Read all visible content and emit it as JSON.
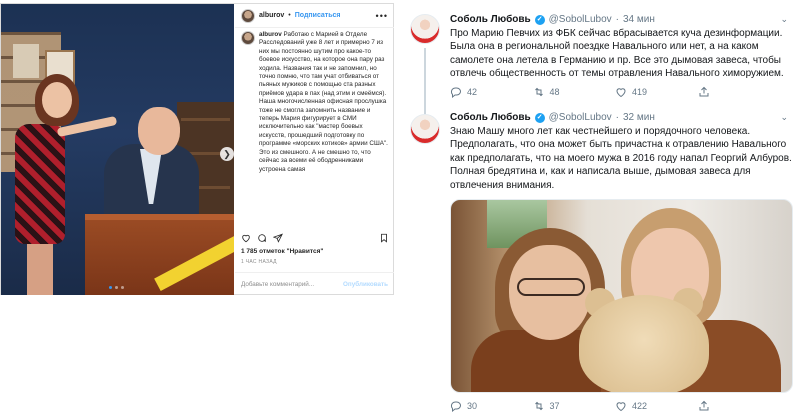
{
  "instagram": {
    "username": "alburov",
    "separator": "•",
    "follow_label": "Подписаться",
    "more_label": "•••",
    "caption": {
      "author": "alburov",
      "text": "Работаю с Марией в Отделе Расследований уже 8 лет и примерно 7 из них мы постоянно шутим про какое-то боевое искусство, на которое она пару раз ходила. Названия так и не запомнил, но точно помню, что там учат отбиваться от пьяных мужиков с помощью ста разных приёмов удара в пах (над этим и смеёмся). Наша многочисленная офисная прослушка тоже не смогла запомнить название и теперь Мария фигурирует в СМИ исключительно как \"мастер боевых искусств, прошедший подготовку по программе «морских котиков» армии США\". Это из смешного. А не смешно то, что сейчас за всеми её ободренниками устроена самая"
    },
    "likes": "1 785 отметок \"Нравится\"",
    "time": "1 ЧАС НАЗАД",
    "comment_placeholder": "Добавьте комментарий...",
    "post_label": "Опубликовать",
    "colors": {
      "link": "#3897f0",
      "border": "#dbdbdb"
    },
    "icons": [
      "heart-icon",
      "comment-icon",
      "share-icon",
      "bookmark-icon"
    ]
  },
  "twitter": {
    "tweets": [
      {
        "name": "Соболь Любовь",
        "handle": "@SobolLubov",
        "dot": "·",
        "time": "34 мин",
        "text": "Про Марию Певчих из ФБК сейчас вбрасывается куча дезинформации. Была она в региональной поездке Навального или нет, а на каком самолете она летела в Германию и пр. Все это дымовая завеса, чтобы отвлечь общественность от темы отравления Навального химоружием.",
        "replies": "42",
        "retweets": "48",
        "likes": "419"
      },
      {
        "name": "Соболь Любовь",
        "handle": "@SobolLubov",
        "dot": "·",
        "time": "32 мин",
        "text": "Знаю Машу много лет как честнейшего и порядочного человека. Предполагать, что она может быть причастна к отравлению Навального как предполагать, что на моего мужа в 2016 году напал Георгий Албуров. Полная бредятина и, как и написала выше, дымовая завеса для отвлечения внимания.",
        "replies": "30",
        "retweets": "37",
        "likes": "422"
      }
    ],
    "colors": {
      "verified": "#1da1f2",
      "muted": "#657786"
    },
    "icons": [
      "reply-icon",
      "retweet-icon",
      "like-icon",
      "share-icon",
      "verified-badge-icon"
    ]
  }
}
